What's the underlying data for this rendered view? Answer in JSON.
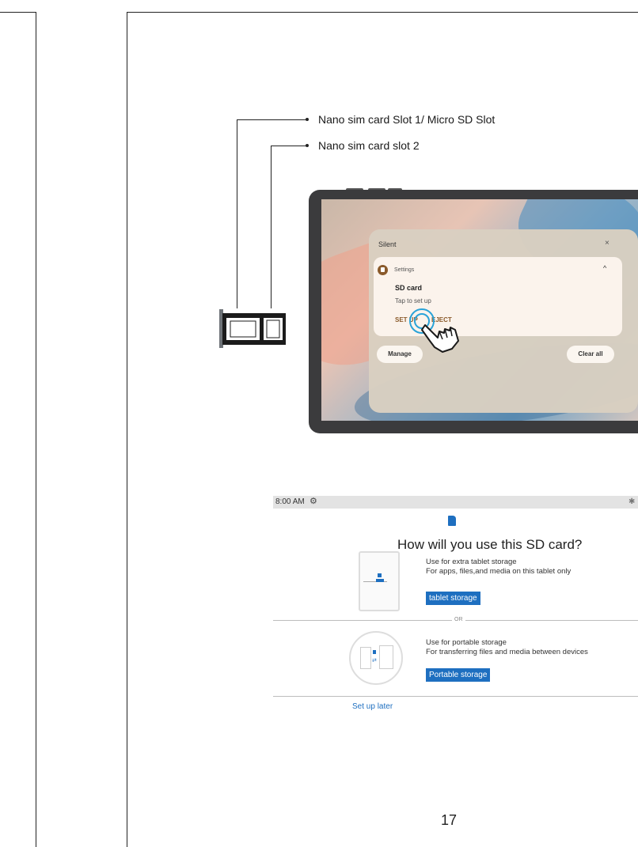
{
  "callouts": {
    "slot1": "Nano sim card Slot 1/ Micro SD Slot",
    "slot2": "Nano sim card slot 2"
  },
  "notification_panel": {
    "header": "Silent",
    "close_symbol": "×",
    "app_name": "Settings",
    "title": "SD card",
    "subtitle": "Tap to set up",
    "action_setup": "SET UP",
    "action_eject": "EJECT",
    "manage_label": "Manage",
    "clear_all_label": "Clear all",
    "expand_symbol": "^"
  },
  "sd_dialog": {
    "status_time": "8:00 AM",
    "title": "How will you use this SD card?",
    "option1_line1": "Use for extra tablet storage",
    "option1_line2": "For apps, files,and media on this tablet only",
    "option1_button": "tablet storage",
    "or_label": "OR",
    "option2_line1": "Use for portable storage",
    "option2_line2": "For transferring files and media between devices",
    "option2_button": "Portable storage",
    "setup_later": "Set up later"
  },
  "page_number": "17",
  "colors": {
    "accent_blue": "#1e6fc0",
    "brown_action": "#8a5a2b",
    "tap_ring": "#2aa3d8"
  }
}
